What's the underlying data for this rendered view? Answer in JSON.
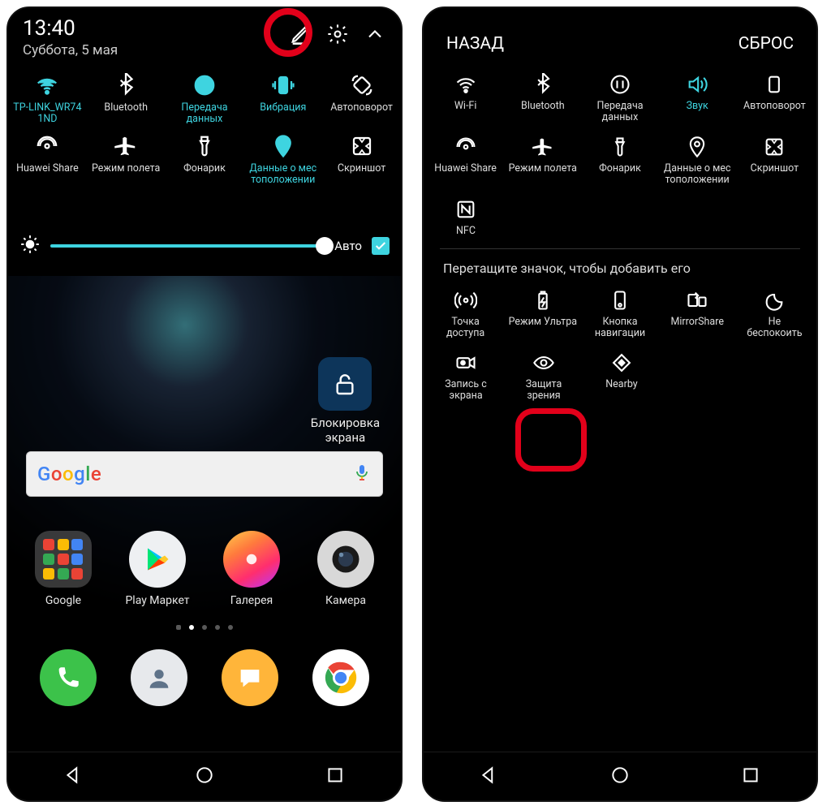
{
  "left": {
    "time": "13:40",
    "date": "Суббота, 5 мая",
    "qs": [
      {
        "label": "TP-LINK_WR74\n1ND",
        "icon": "wifi",
        "active": true
      },
      {
        "label": "Bluetooth",
        "icon": "bluetooth",
        "active": false
      },
      {
        "label": "Передача\nданных",
        "icon": "data",
        "active": true
      },
      {
        "label": "Вибрация",
        "icon": "vibrate",
        "active": true
      },
      {
        "label": "Автоповорот",
        "icon": "rotate",
        "active": false
      },
      {
        "label": "Huawei Share",
        "icon": "hshare",
        "active": false
      },
      {
        "label": "Режим полета",
        "icon": "plane",
        "active": false
      },
      {
        "label": "Фонарик",
        "icon": "torch",
        "active": false
      },
      {
        "label": "Данные о мес\nтоположении",
        "icon": "location",
        "active": true
      },
      {
        "label": "Скриншот",
        "icon": "screenshot",
        "active": false
      }
    ],
    "auto_label": "Авто",
    "lock_label": "Блокировка\nэкрана",
    "search_brand": "Google",
    "apps": [
      {
        "label": "Google"
      },
      {
        "label": "Play Маркет"
      },
      {
        "label": "Галерея"
      },
      {
        "label": "Камера"
      }
    ]
  },
  "right": {
    "back": "НАЗАД",
    "reset": "СБРОС",
    "top": [
      {
        "label": "Wi-Fi",
        "icon": "wifi"
      },
      {
        "label": "Bluetooth",
        "icon": "bluetooth"
      },
      {
        "label": "Передача\nданных",
        "icon": "data"
      },
      {
        "label": "Звук",
        "icon": "sound",
        "active": true
      },
      {
        "label": "Автоповорот",
        "icon": "rotate2"
      },
      {
        "label": "Huawei Share",
        "icon": "hshare"
      },
      {
        "label": "Режим полета",
        "icon": "plane"
      },
      {
        "label": "Фонарик",
        "icon": "torch"
      },
      {
        "label": "Данные о мес\nтоположении",
        "icon": "location"
      },
      {
        "label": "Скриншот",
        "icon": "screenshot"
      },
      {
        "label": "NFC",
        "icon": "nfc"
      }
    ],
    "instruction": "Перетащите значок, чтобы добавить его",
    "bottom": [
      {
        "label": "Точка\nдоступа",
        "icon": "hotspot"
      },
      {
        "label": "Режим Ультра",
        "icon": "battery"
      },
      {
        "label": "Кнопка\nнавигации",
        "icon": "navbtn"
      },
      {
        "label": "MirrorShare",
        "icon": "mirror"
      },
      {
        "label": "Не\nбеспокоить",
        "icon": "dnd"
      },
      {
        "label": "Запись с\nэкрана",
        "icon": "record"
      },
      {
        "label": "Защита\nзрения",
        "icon": "eye"
      },
      {
        "label": "Nearby",
        "icon": "nearby"
      }
    ]
  }
}
